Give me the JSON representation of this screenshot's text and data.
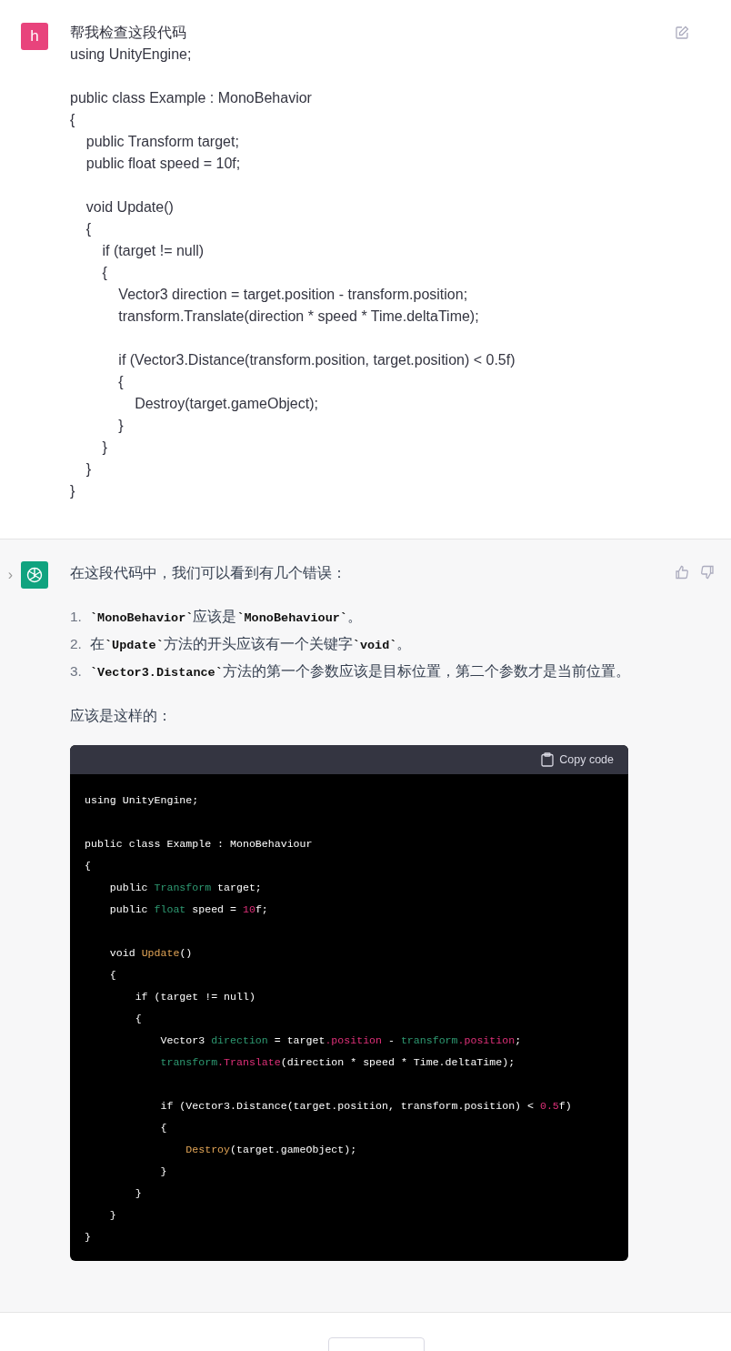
{
  "user_message": {
    "avatar_letter": "h",
    "lines": [
      {
        "kind": "text",
        "text": "帮我检查这段代码"
      },
      {
        "kind": "text",
        "text": "using UnityEngine;"
      },
      {
        "kind": "blank"
      },
      {
        "kind": "text",
        "text": "public class Example : MonoBehavior"
      },
      {
        "kind": "text",
        "text": "{"
      },
      {
        "kind": "text",
        "text": "    public Transform target;"
      },
      {
        "kind": "text",
        "text": "    public float speed = 10f;"
      },
      {
        "kind": "blank"
      },
      {
        "kind": "text",
        "text": "    void Update()"
      },
      {
        "kind": "text",
        "text": "    {"
      },
      {
        "kind": "text",
        "text": "        if (target != null)"
      },
      {
        "kind": "text",
        "text": "        {"
      },
      {
        "kind": "text",
        "text": "            Vector3 direction = target.position - transform.position;"
      },
      {
        "kind": "text",
        "text": "            transform.Translate(direction * speed * Time.deltaTime);"
      },
      {
        "kind": "blank"
      },
      {
        "kind": "text",
        "text": "            if (Vector3.Distance(transform.position, target.position) < 0.5f)"
      },
      {
        "kind": "text",
        "text": "            {"
      },
      {
        "kind": "text",
        "text": "                Destroy(target.gameObject);"
      },
      {
        "kind": "text",
        "text": "            }"
      },
      {
        "kind": "text",
        "text": "        }"
      },
      {
        "kind": "text",
        "text": "    }"
      },
      {
        "kind": "text",
        "text": "}"
      }
    ]
  },
  "assistant_message": {
    "collapse_glyph": "›",
    "intro": "在这段代码中，我们可以看到有几个错误：",
    "list": [
      {
        "number": "1.",
        "text": "**`MonoBehavior`**应该是**`MonoBehaviour`**。"
      },
      {
        "number": "2.",
        "text": "在**`Update`**方法的开头应该有一个关键字**`void`**。"
      },
      {
        "number": "3.",
        "text": "**`Vector3.Distance`**方法的第一个参数应该是目标位置，第二个参数才是当前位置。"
      }
    ],
    "lead": "应该是这样的：",
    "code_block": {
      "copy_label": "Copy code",
      "lines": [
        {
          "kind": "code",
          "tokens": [
            {
              "kind": "plain",
              "text": "using UnityEngine;"
            }
          ]
        },
        {
          "kind": "blank"
        },
        {
          "kind": "code",
          "tokens": [
            {
              "kind": "plain",
              "text": "public class Example : MonoBehaviour"
            }
          ]
        },
        {
          "kind": "code",
          "tokens": [
            {
              "kind": "plain",
              "text": "{"
            }
          ]
        },
        {
          "kind": "code",
          "tokens": [
            {
              "kind": "plain",
              "text": "    public "
            },
            {
              "kind": "type",
              "text": "Transform"
            },
            {
              "kind": "plain",
              "text": " target;"
            }
          ]
        },
        {
          "kind": "code",
          "tokens": [
            {
              "kind": "plain",
              "text": "    public "
            },
            {
              "kind": "type",
              "text": "float"
            },
            {
              "kind": "plain",
              "text": " speed = "
            },
            {
              "kind": "literal",
              "text": "10"
            },
            {
              "kind": "plain",
              "text": "f;"
            }
          ]
        },
        {
          "kind": "blank"
        },
        {
          "kind": "code",
          "tokens": [
            {
              "kind": "plain",
              "text": "    void "
            },
            {
              "kind": "title",
              "text": "Update"
            },
            {
              "kind": "plain",
              "text": "()"
            }
          ]
        },
        {
          "kind": "code",
          "tokens": [
            {
              "kind": "plain",
              "text": "    {"
            }
          ]
        },
        {
          "kind": "code",
          "tokens": [
            {
              "kind": "plain",
              "text": "        if (target != null)"
            }
          ]
        },
        {
          "kind": "code",
          "tokens": [
            {
              "kind": "plain",
              "text": "        {"
            }
          ]
        },
        {
          "kind": "code",
          "tokens": [
            {
              "kind": "plain",
              "text": "            Vector3 "
            },
            {
              "kind": "type",
              "text": "direction"
            },
            {
              "kind": "plain",
              "text": " = target"
            },
            {
              "kind": "literal",
              "text": ".position"
            },
            {
              "kind": "plain",
              "text": " - "
            },
            {
              "kind": "type",
              "text": "transform"
            },
            {
              "kind": "literal",
              "text": ".position"
            },
            {
              "kind": "plain",
              "text": ";"
            }
          ]
        },
        {
          "kind": "code",
          "tokens": [
            {
              "kind": "type",
              "text": "            transform"
            },
            {
              "kind": "literal",
              "text": ".Translate"
            },
            {
              "kind": "plain",
              "text": "(direction * speed * Time.deltaTime);"
            }
          ]
        },
        {
          "kind": "blank"
        },
        {
          "kind": "code",
          "tokens": [
            {
              "kind": "plain",
              "text": "            if (Vector3.Distance(target.position, transform.position) < "
            },
            {
              "kind": "literal",
              "text": "0.5"
            },
            {
              "kind": "plain",
              "text": "f)"
            }
          ]
        },
        {
          "kind": "code",
          "tokens": [
            {
              "kind": "plain",
              "text": "            {"
            }
          ]
        },
        {
          "kind": "code",
          "tokens": [
            {
              "kind": "title",
              "text": "                Destroy"
            },
            {
              "kind": "plain",
              "text": "(target.gameObject);"
            }
          ]
        },
        {
          "kind": "code",
          "tokens": [
            {
              "kind": "plain",
              "text": "            }"
            }
          ]
        },
        {
          "kind": "code",
          "tokens": [
            {
              "kind": "plain",
              "text": "        }"
            }
          ]
        },
        {
          "kind": "code",
          "tokens": [
            {
              "kind": "plain",
              "text": "    }"
            }
          ]
        },
        {
          "kind": "code",
          "tokens": [
            {
              "kind": "plain",
              "text": "}"
            }
          ]
        }
      ]
    }
  }
}
